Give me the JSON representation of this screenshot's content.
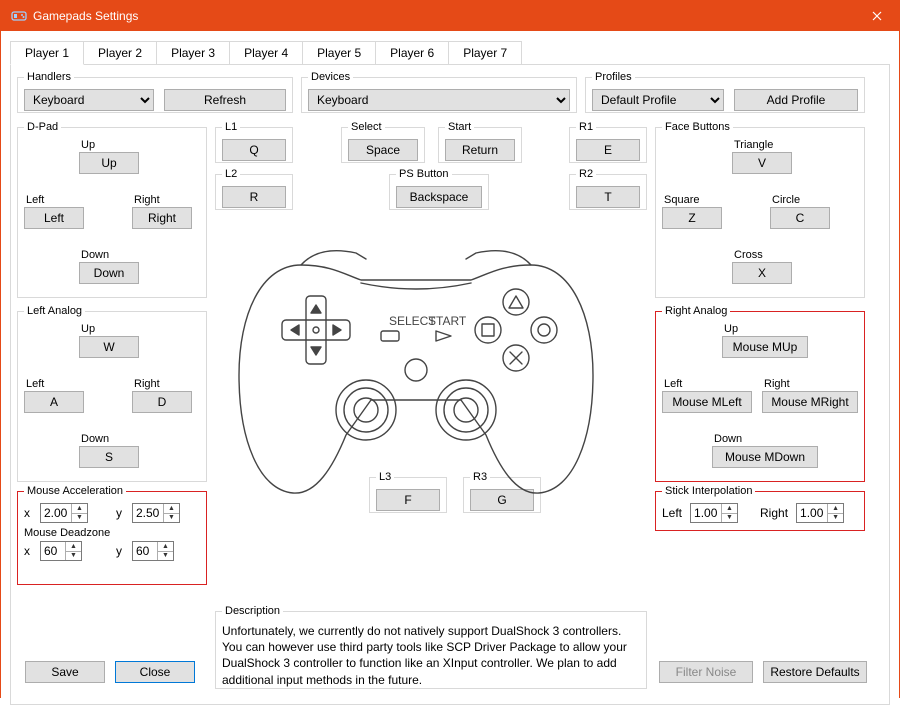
{
  "window": {
    "title": "Gamepads Settings"
  },
  "tabs": [
    "Player 1",
    "Player 2",
    "Player 3",
    "Player 4",
    "Player 5",
    "Player 6",
    "Player 7"
  ],
  "activeTab": 0,
  "handlers": {
    "legend": "Handlers",
    "selected": "Keyboard",
    "refresh": "Refresh"
  },
  "devices": {
    "legend": "Devices",
    "selected": "Keyboard"
  },
  "profiles": {
    "legend": "Profiles",
    "selected": "Default Profile",
    "add": "Add Profile"
  },
  "dpad": {
    "legend": "D-Pad",
    "up": {
      "label": "Up",
      "value": "Up"
    },
    "left": {
      "label": "Left",
      "value": "Left"
    },
    "right": {
      "label": "Right",
      "value": "Right"
    },
    "down": {
      "label": "Down",
      "value": "Down"
    }
  },
  "l1": {
    "legend": "L1",
    "value": "Q"
  },
  "l2": {
    "legend": "L2",
    "value": "R"
  },
  "r1": {
    "legend": "R1",
    "value": "E"
  },
  "r2": {
    "legend": "R2",
    "value": "T"
  },
  "select_btn": {
    "legend": "Select",
    "value": "Space"
  },
  "start": {
    "legend": "Start",
    "value": "Return"
  },
  "psbtn": {
    "legend": "PS Button",
    "value": "Backspace"
  },
  "faceButtons": {
    "legend": "Face Buttons",
    "triangle": {
      "label": "Triangle",
      "value": "V"
    },
    "square": {
      "label": "Square",
      "value": "Z"
    },
    "circle": {
      "label": "Circle",
      "value": "C"
    },
    "cross": {
      "label": "Cross",
      "value": "X"
    }
  },
  "leftAnalog": {
    "legend": "Left Analog",
    "up": {
      "label": "Up",
      "value": "W"
    },
    "left": {
      "label": "Left",
      "value": "A"
    },
    "right": {
      "label": "Right",
      "value": "D"
    },
    "down": {
      "label": "Down",
      "value": "S"
    }
  },
  "rightAnalog": {
    "legend": "Right Analog",
    "up": {
      "label": "Up",
      "value": "Mouse MUp"
    },
    "left": {
      "label": "Left",
      "value": "Mouse MLeft"
    },
    "right": {
      "label": "Right",
      "value": "Mouse MRight"
    },
    "down": {
      "label": "Down",
      "value": "Mouse MDown"
    }
  },
  "l3": {
    "legend": "L3",
    "value": "F"
  },
  "r3": {
    "legend": "R3",
    "value": "G"
  },
  "mouseAccel": {
    "legend": "Mouse Acceleration",
    "xLabel": "x",
    "x": "2.00",
    "yLabel": "y",
    "y": "2.50"
  },
  "mouseDead": {
    "legend": "Mouse Deadzone",
    "xLabel": "x",
    "x": "60",
    "yLabel": "y",
    "y": "60"
  },
  "stickInterp": {
    "legend": "Stick Interpolation",
    "leftLabel": "Left",
    "left": "1.00",
    "rightLabel": "Right",
    "right": "1.00"
  },
  "description": {
    "legend": "Description",
    "text": "Unfortunately, we currently do not natively support DualShock 3 controllers. You can however use third party tools like SCP Driver Package to allow your DualShock 3 controller to function like an XInput controller.  We plan to add additional input methods in the future."
  },
  "footer": {
    "save": "Save",
    "close": "Close",
    "filter": "Filter Noise",
    "restore": "Restore Defaults"
  }
}
